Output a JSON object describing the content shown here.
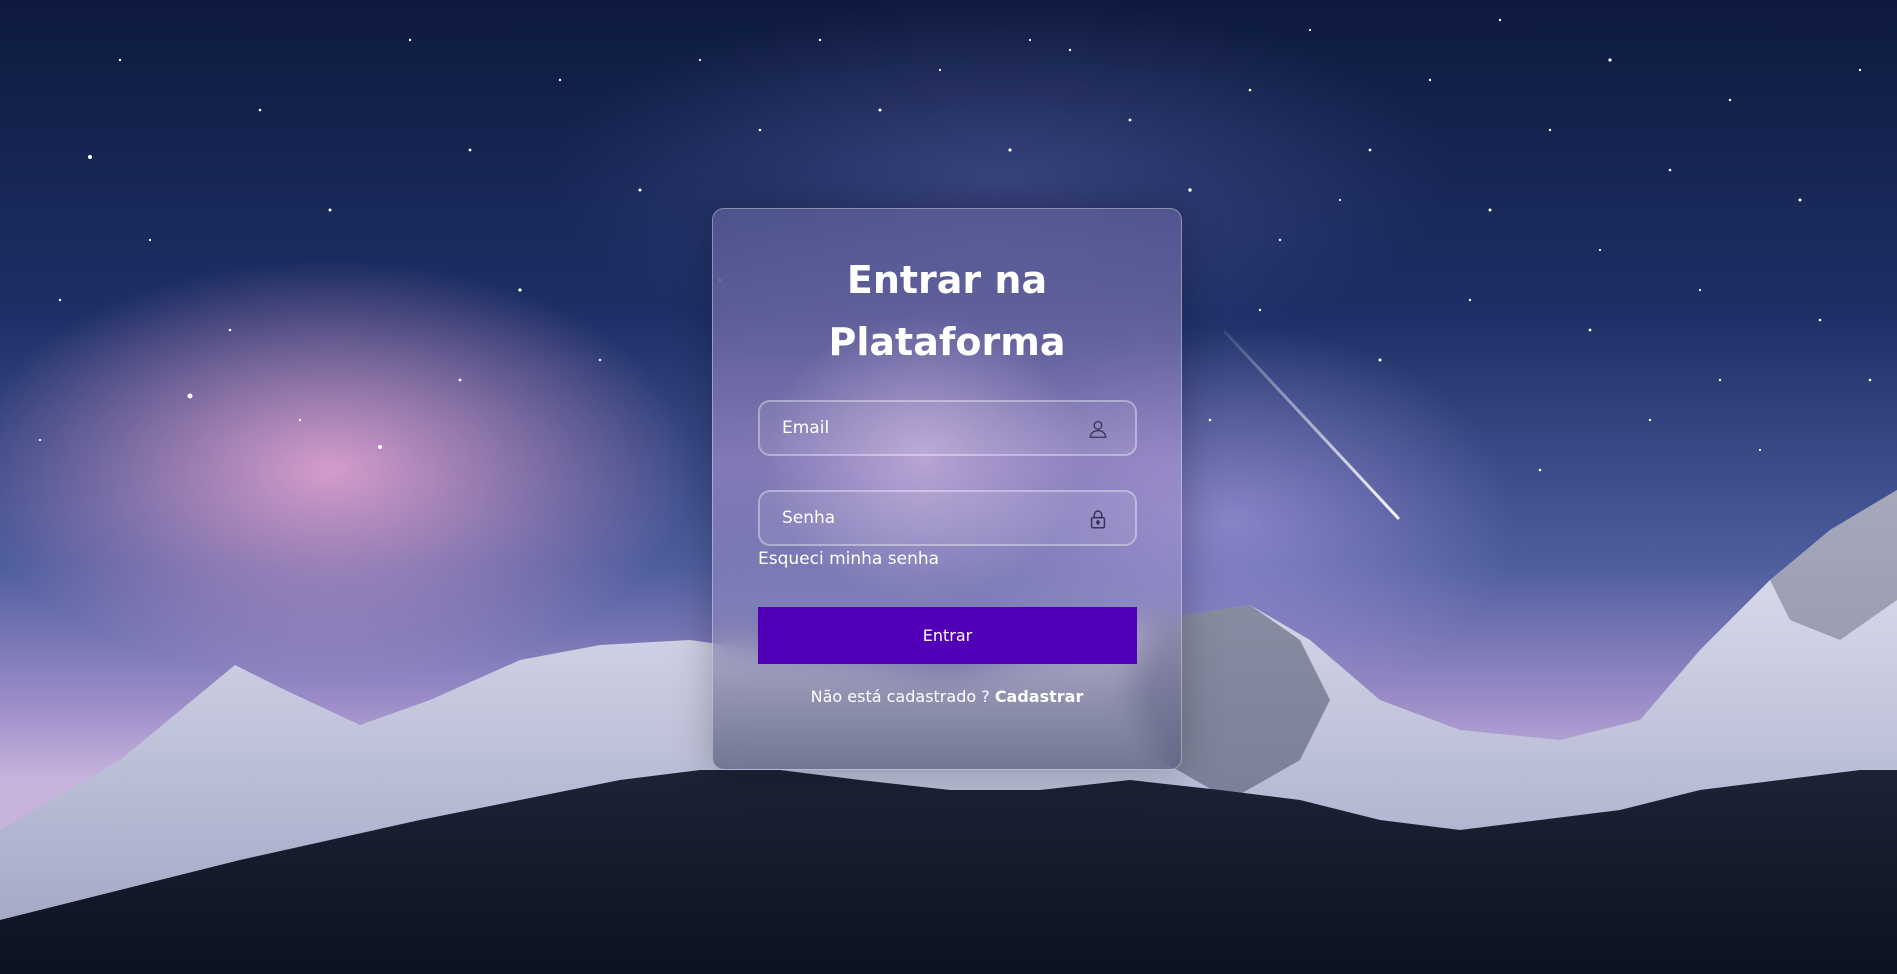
{
  "login": {
    "title_line1": "Entrar na",
    "title_line2": "Plataforma",
    "email": {
      "placeholder": "Email",
      "value": "",
      "icon": "user-icon"
    },
    "password": {
      "placeholder": "Senha",
      "value": "",
      "icon": "lock-icon"
    },
    "forgot_password": "Esqueci minha senha",
    "submit_label": "Entrar",
    "signup_prompt": "Não está cadastrado ?",
    "signup_link": "Cadastrar"
  },
  "colors": {
    "button": "#5200b8",
    "text": "#ffffff"
  },
  "background": {
    "icon": "starry-sky-mountains-image"
  }
}
